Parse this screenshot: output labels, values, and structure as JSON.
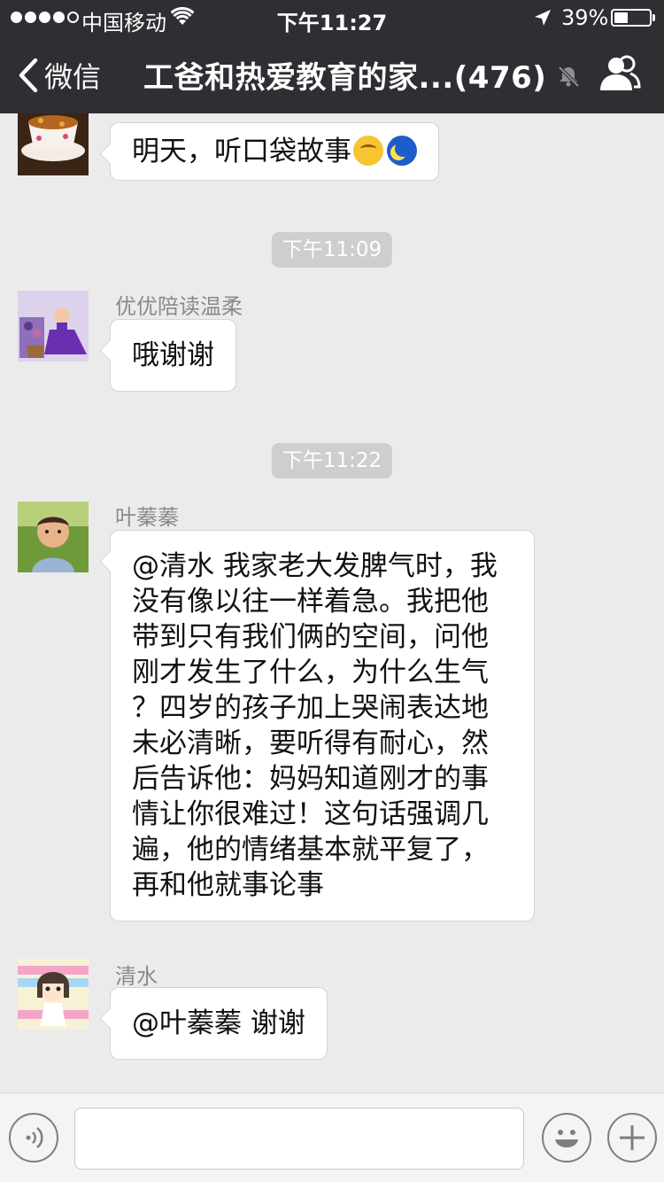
{
  "status_bar": {
    "carrier": "中国移动",
    "time": "下午11:27",
    "battery_text": "39%",
    "battery_level": 0.39,
    "signal_bars_filled": 4,
    "signal_bars_total": 5
  },
  "nav": {
    "back_label": "微信",
    "title": "工爸和热爱教育的家...(476)",
    "icons": [
      "chevron-left-icon",
      "bell-muted-icon",
      "group-members-icon"
    ]
  },
  "messages": [
    {
      "type": "text",
      "sender": "",
      "text": "明天，听口袋故事",
      "emojis": [
        "thinking-face-emoji",
        "crescent-moon-emoji"
      ]
    },
    {
      "type": "time",
      "text": "下午11:09"
    },
    {
      "type": "text",
      "sender": "优优陪读温柔",
      "text": "哦谢谢"
    },
    {
      "type": "time",
      "text": "下午11:22"
    },
    {
      "type": "text",
      "sender": "叶蓁蓁",
      "text": "@清水 我家老大发脾气时，我\n没有像以往一样着急。我把他\n带到只有我们俩的空间，问他\n刚才发生了什么，为什么生气\n？四岁的孩子加上哭闹表达地\n未必清晰，要听得有耐心，然\n后告诉他：妈妈知道刚才的事\n情让你很难过！这句话强调几\n遍，他的情绪基本就平复了，\n再和他就事论事"
    },
    {
      "type": "text",
      "sender": "清水",
      "text": "@叶蓁蓁 谢谢"
    }
  ],
  "input_bar": {
    "icons": [
      "voice-icon",
      "emoji-smile-icon",
      "plus-icon"
    ],
    "text_value": ""
  },
  "colors": {
    "header_bg": "#2e2e33",
    "chat_bg": "#ebebeb",
    "bubble_bg": "#ffffff",
    "time_pill_bg": "#cecece",
    "nickname": "#8a8a8a"
  }
}
